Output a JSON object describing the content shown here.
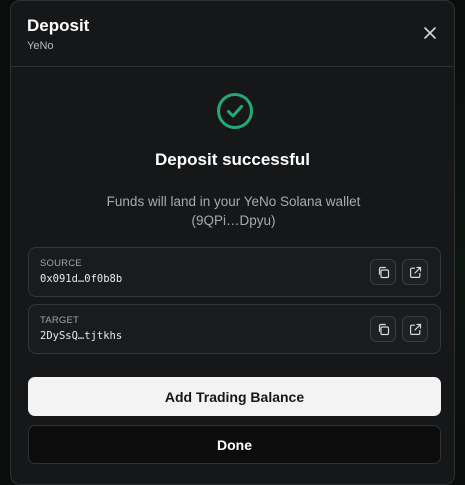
{
  "header": {
    "title": "Deposit",
    "subtitle": "YeNo"
  },
  "status": {
    "title": "Deposit successful",
    "description_line1": "Funds will land in your YeNo Solana wallet",
    "description_line2": "(9QPi…Dpyu)",
    "icon": "check-circle-icon",
    "icon_color": "#25a878"
  },
  "addresses": [
    {
      "label": "SOURCE",
      "value": "0x091d…0f0b8b"
    },
    {
      "label": "TARGET",
      "value": "2DySsQ…tjtkhs"
    }
  ],
  "actions": {
    "primary_label": "Add Trading Balance",
    "secondary_label": "Done"
  },
  "colors": {
    "modal_bg": "#161718",
    "primary_button_bg": "#f3f3f4",
    "secondary_button_bg": "#0c0c0d"
  }
}
